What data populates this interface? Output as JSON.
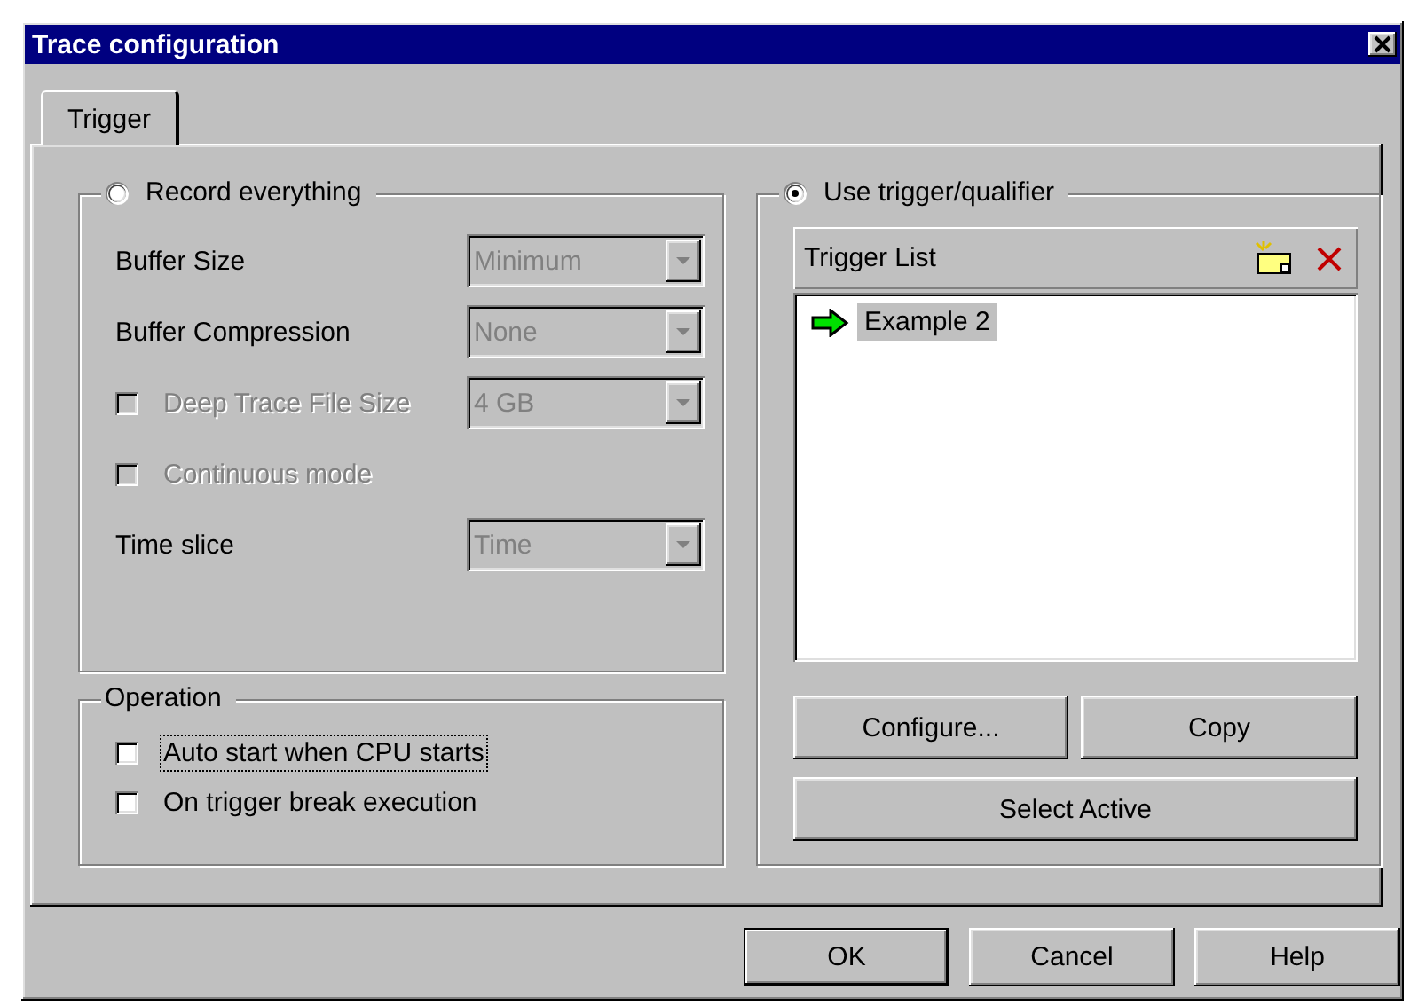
{
  "window": {
    "title": "Trace configuration"
  },
  "tabs": [
    {
      "label": "Trigger",
      "selected": true
    }
  ],
  "record_group": {
    "label": "Record everything",
    "selected": false,
    "fields": [
      {
        "kind": "combo",
        "label": "Buffer Size",
        "value": "Minimum",
        "disabled": true
      },
      {
        "kind": "combo",
        "label": "Buffer Compression",
        "value": "None",
        "disabled": true
      },
      {
        "kind": "check_combo",
        "label": "Deep Trace File Size",
        "checked": false,
        "value": "4 GB",
        "disabled": true
      },
      {
        "kind": "check",
        "label": "Continuous mode",
        "checked": false,
        "disabled": true
      },
      {
        "kind": "combo",
        "label": "Time slice",
        "value": "Time",
        "disabled": true
      }
    ]
  },
  "operation": {
    "title": "Operation",
    "options": [
      {
        "label": "Auto start when CPU starts",
        "checked": false,
        "focused": true
      },
      {
        "label": "On trigger break execution",
        "checked": false,
        "focused": false
      }
    ]
  },
  "trigger_group": {
    "label": "Use trigger/qualifier",
    "selected": true,
    "list_title": "Trigger List",
    "items": [
      {
        "label": "Example 2",
        "selected": true,
        "active": true
      }
    ],
    "buttons": [
      {
        "label": "Configure..."
      },
      {
        "label": "Copy"
      },
      {
        "label": "Select Active"
      }
    ]
  },
  "buttons": [
    {
      "label": "OK",
      "default": true
    },
    {
      "label": "Cancel",
      "default": false
    },
    {
      "label": "Help",
      "default": false
    }
  ]
}
